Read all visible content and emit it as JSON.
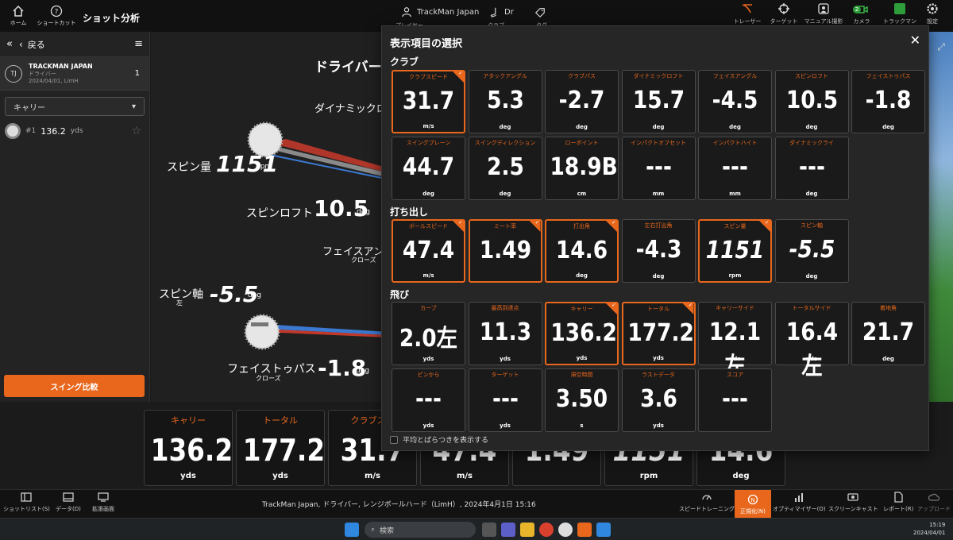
{
  "topbar": {
    "home_label": "ホーム",
    "shortcut_label": "ショートカット",
    "screen_title": "ショット分析",
    "player_name": "TrackMan Japan",
    "player_sub": "プレイヤー",
    "club_name": "Dr",
    "club_sub": "クラブ",
    "tag_sub": "タグ",
    "right_items": [
      {
        "label": "トレーサー",
        "icon": "tracer-icon"
      },
      {
        "label": "ターゲット",
        "icon": "target-icon"
      },
      {
        "label": "マニュアル撮影",
        "icon": "manual-capture-icon"
      },
      {
        "label": "カメラ",
        "icon": "camera-icon",
        "badge": "2"
      },
      {
        "label": "トラックマン",
        "icon": "trackman-icon"
      },
      {
        "label": "設定",
        "icon": "settings-icon"
      }
    ]
  },
  "left_panel": {
    "back_label": "戻る",
    "session": {
      "initials": "TJ",
      "name": "TRACKMAN JAPAN",
      "club": "ドライバー",
      "meta": "2024/04/01, LimH",
      "count": "1"
    },
    "dropdown_value": "キャリー",
    "shot": {
      "number": "#1",
      "value": "136.2",
      "unit": "yds"
    },
    "compare_button": "スイング比較"
  },
  "diagram": {
    "title": "ドライバー",
    "dynamic_loft_label": "ダイナミックロ",
    "spin_label": "スピン量",
    "spin_value": "1151",
    "spin_unit": "rpm",
    "spin_loft_label": "スピンロフト",
    "spin_loft_value": "10.5",
    "spin_loft_unit": "deg",
    "face_angle_label": "フェイスアン",
    "face_angle_sub": "クローズ",
    "spin_axis_label": "スピン軸",
    "spin_axis_sub": "左",
    "spin_axis_value": "-5.5",
    "spin_axis_unit": "deg",
    "face_to_path_label": "フェイストゥパス",
    "face_to_path_sub": "クローズ",
    "face_to_path_value": "-1.8",
    "face_to_path_unit": "deg"
  },
  "bottom_tiles": [
    {
      "header": "キャリー",
      "value": "136.2",
      "unit": "yds"
    },
    {
      "header": "トータル",
      "value": "177.2",
      "unit": "yds"
    },
    {
      "header": "クラブスピ",
      "value": "31.7",
      "unit": "m/s"
    },
    {
      "header": "",
      "value": "47.4",
      "unit": "m/s"
    },
    {
      "header": "",
      "value": "1.49",
      "unit": ""
    },
    {
      "header": "",
      "value": "1151",
      "unit": "rpm"
    },
    {
      "header": "",
      "value": "14.6",
      "unit": "deg"
    }
  ],
  "overlay": {
    "title": "表示項目の選択",
    "sections": {
      "club": "クラブ",
      "launch": "打ち出し",
      "flight": "飛び"
    },
    "club_row1": [
      {
        "h": "クラブスピード",
        "v": "31.7",
        "u": "m/s",
        "selected": true
      },
      {
        "h": "アタックアングル",
        "v": "5.3",
        "u": "deg",
        "selected": false
      },
      {
        "h": "クラブパス",
        "v": "-2.7",
        "u": "deg",
        "selected": false
      },
      {
        "h": "ダイナミックロフト",
        "v": "15.7",
        "u": "deg",
        "selected": false
      },
      {
        "h": "フェイスアングル",
        "v": "-4.5",
        "u": "deg",
        "selected": false
      },
      {
        "h": "スピンロフト",
        "v": "10.5",
        "u": "deg",
        "selected": false
      },
      {
        "h": "フェイストゥパス",
        "v": "-1.8",
        "u": "deg",
        "selected": false
      }
    ],
    "club_row2": [
      {
        "h": "スイングプレーン",
        "v": "44.7",
        "u": "deg",
        "selected": false
      },
      {
        "h": "スイングディレクション",
        "v": "2.5",
        "u": "deg",
        "selected": false
      },
      {
        "h": "ローポイント",
        "v": "18.9B",
        "u": "cm",
        "selected": false
      },
      {
        "h": "インパクトオフセット",
        "v": "---",
        "u": "mm",
        "selected": false
      },
      {
        "h": "インパクトハイト",
        "v": "---",
        "u": "mm",
        "selected": false
      },
      {
        "h": "ダイナミックライ",
        "v": "---",
        "u": "deg",
        "selected": false
      }
    ],
    "launch_row": [
      {
        "h": "ボールスピード",
        "v": "47.4",
        "u": "m/s",
        "selected": true
      },
      {
        "h": "ミート率",
        "v": "1.49",
        "u": "",
        "selected": true
      },
      {
        "h": "打出角",
        "v": "14.6",
        "u": "deg",
        "selected": true
      },
      {
        "h": "左右打出角",
        "v": "-4.3",
        "u": "deg",
        "selected": false
      },
      {
        "h": "スピン量",
        "v": "1151",
        "u": "rpm",
        "selected": true,
        "italic": true
      },
      {
        "h": "スピン軸",
        "v": "-5.5",
        "u": "deg",
        "selected": false,
        "italic": true
      }
    ],
    "flight_row1": [
      {
        "h": "カーブ",
        "v": "2.0左",
        "u": "yds",
        "selected": false
      },
      {
        "h": "最高到達点",
        "v": "11.3",
        "u": "yds",
        "selected": false
      },
      {
        "h": "キャリー",
        "v": "136.2",
        "u": "yds",
        "selected": true
      },
      {
        "h": "トータル",
        "v": "177.2",
        "u": "yds",
        "selected": true
      },
      {
        "h": "キャリーサイド",
        "v": "12.1左",
        "u": "yds",
        "selected": false
      },
      {
        "h": "トータルサイド",
        "v": "16.4左",
        "u": "yds",
        "selected": false
      },
      {
        "h": "着地角",
        "v": "21.7",
        "u": "deg",
        "selected": false
      }
    ],
    "flight_row2": [
      {
        "h": "ピンから",
        "v": "---",
        "u": "yds",
        "selected": false
      },
      {
        "h": "ターゲット",
        "v": "---",
        "u": "yds",
        "selected": false
      },
      {
        "h": "滞空時間",
        "v": "3.50",
        "u": "s",
        "selected": false
      },
      {
        "h": "ラストデータ",
        "v": "3.6",
        "u": "yds",
        "selected": false
      },
      {
        "h": "スコア",
        "v": "---",
        "u": "",
        "selected": false
      }
    ],
    "show_avg_label": "平均とばらつきを表示する"
  },
  "bottombar": {
    "shotlist": "ショットリスト(S)",
    "data": "データ(D)",
    "expand": "拡張画面",
    "status": "TrackMan Japan, ドライバー, レンジボールハード（LimH）, 2024年4月1日 15:16",
    "speed_training": "スピードトレーニング",
    "normalize": "正規化(N)",
    "optimizer": "オプティマイザー(O)",
    "screencast": "スクリーンキャスト",
    "report": "レポート(R)",
    "upload": "アップロード"
  },
  "taskbar": {
    "search_placeholder": "検索",
    "time": "15:19",
    "date": "2024/04/01"
  },
  "colors": {
    "accent": "#e8671c",
    "bg": "#1a1a1a"
  }
}
